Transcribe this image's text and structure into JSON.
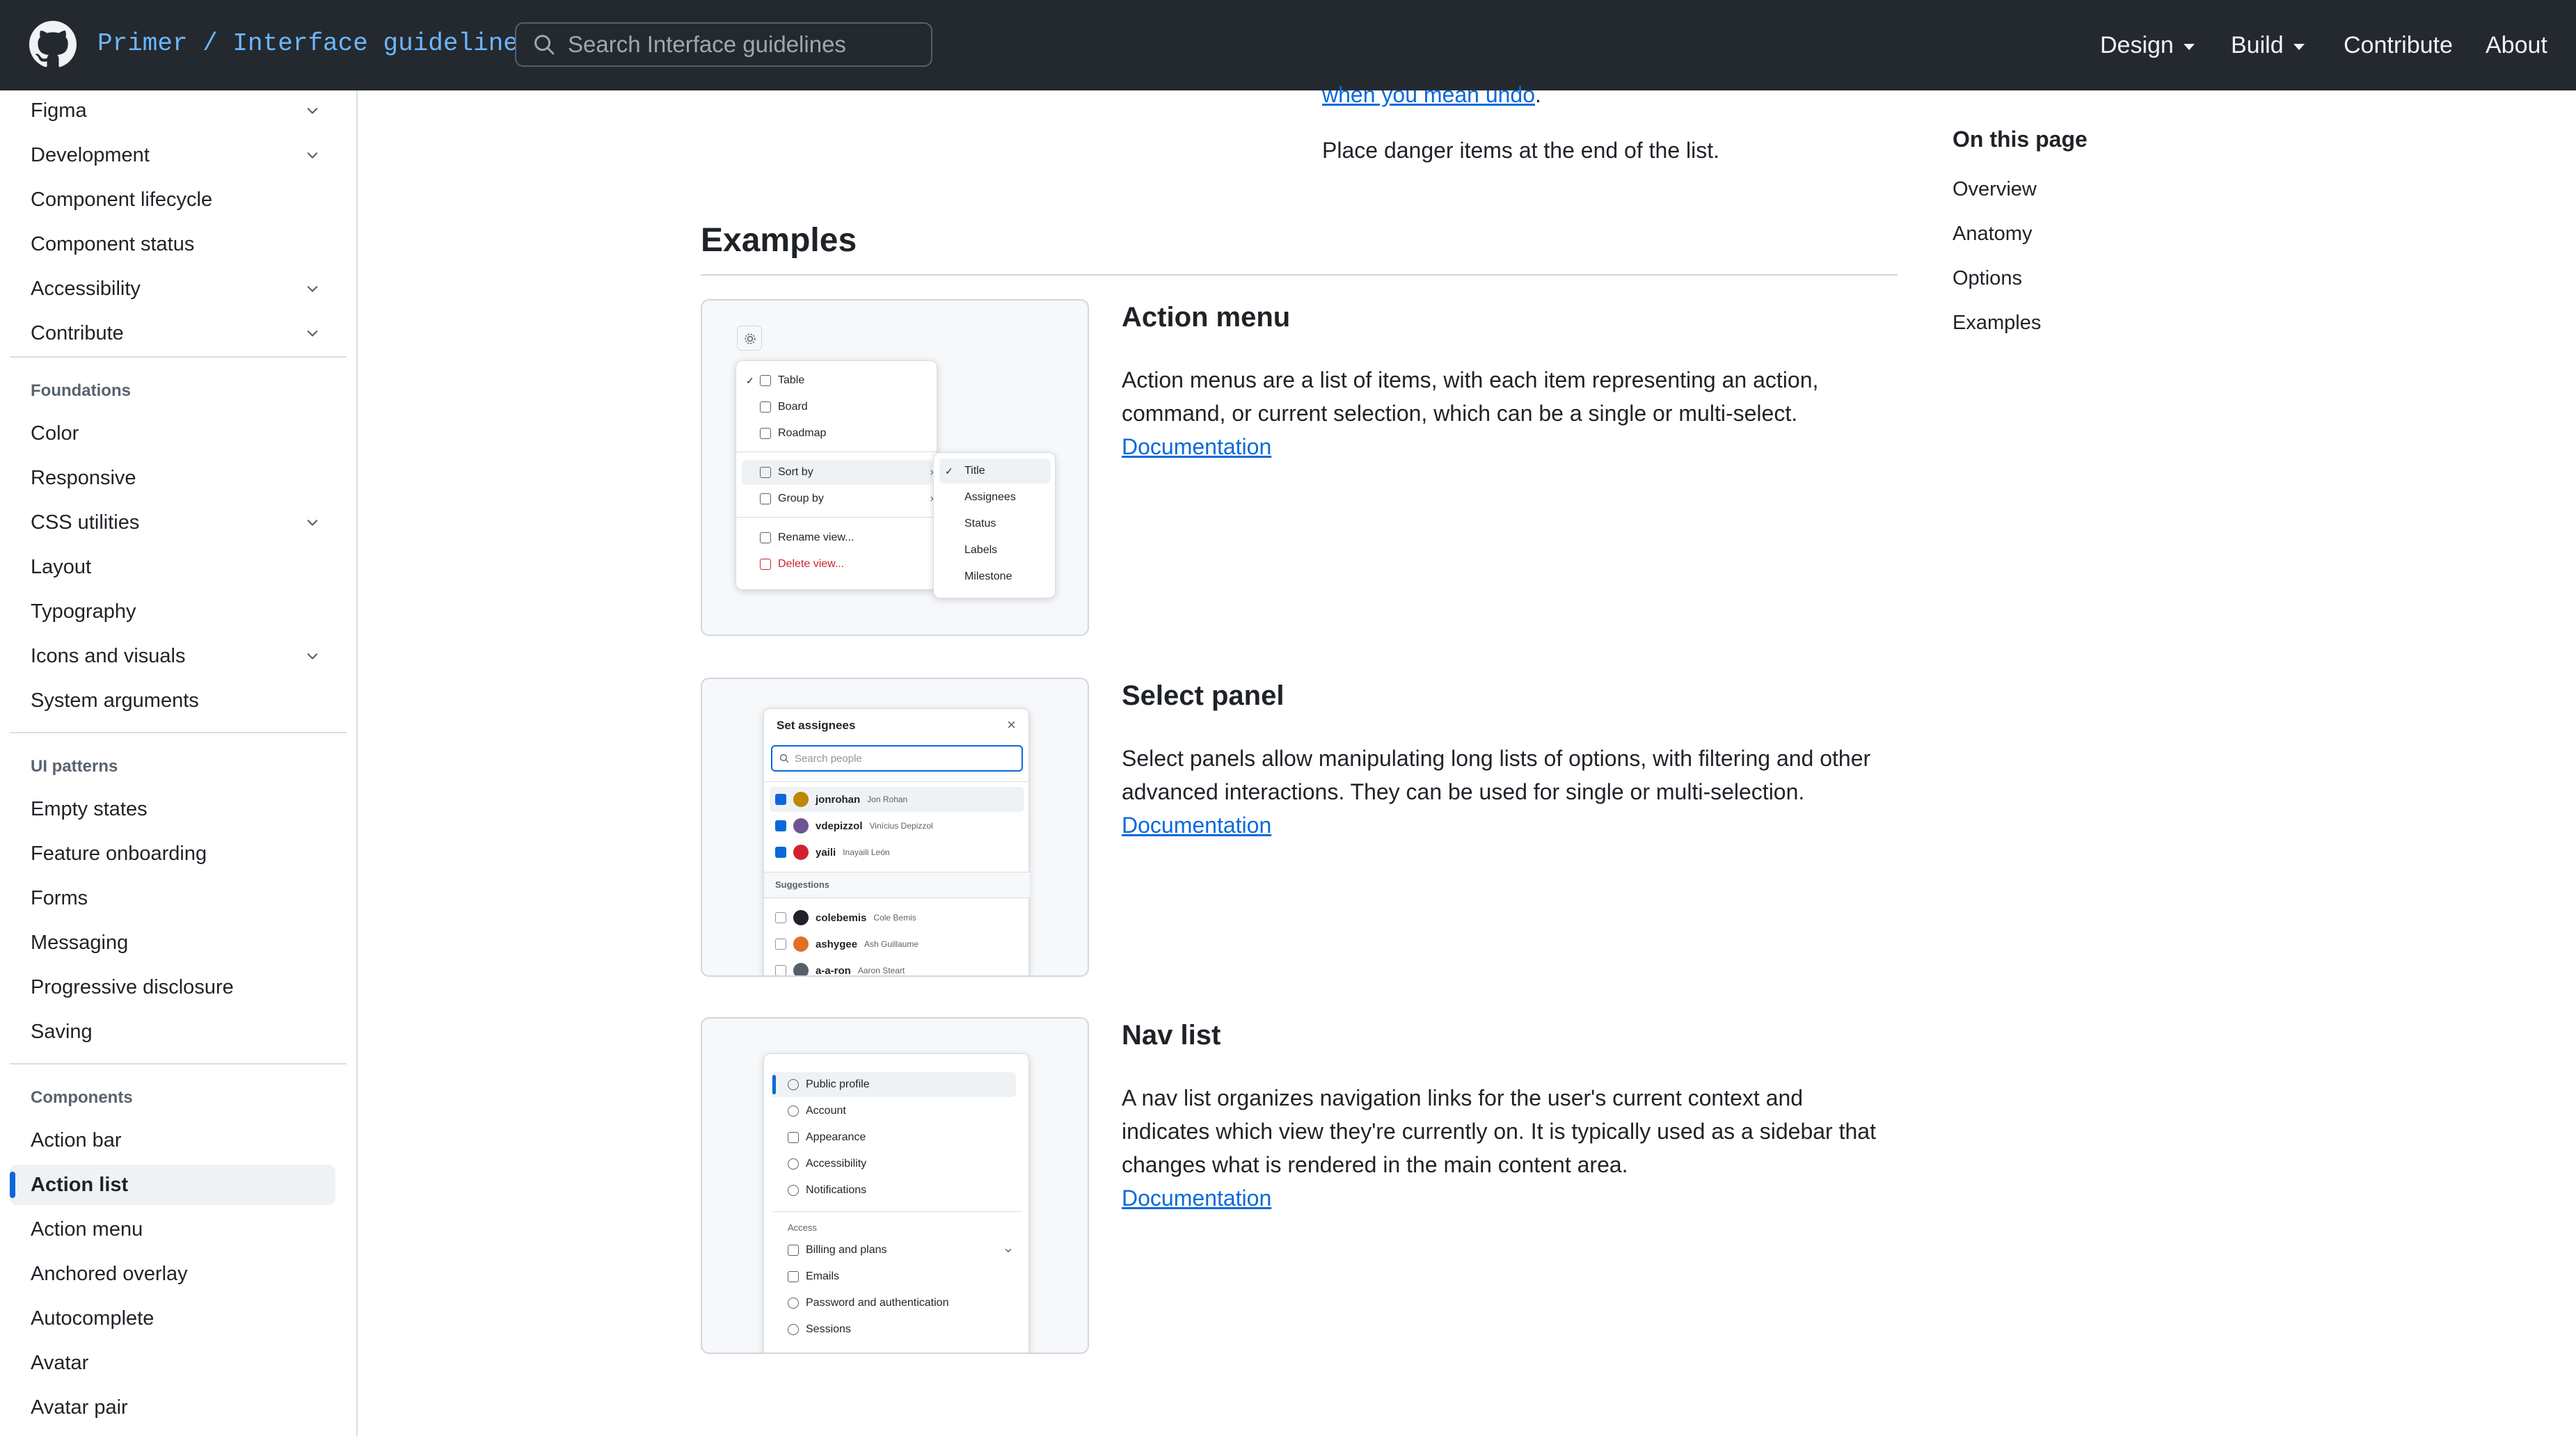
{
  "header": {
    "brand": "Primer / Interface guidelines",
    "search_placeholder": "Search Interface guidelines",
    "nav": {
      "design": "Design",
      "build": "Build",
      "contribute": "Contribute",
      "about": "About"
    }
  },
  "sidebar": {
    "top_items": [
      "Figma",
      "Development",
      "Component lifecycle",
      "Component status",
      "Accessibility",
      "Contribute"
    ],
    "foundations_heading": "Foundations",
    "foundations": [
      "Color",
      "Responsive",
      "CSS utilities",
      "Layout",
      "Typography",
      "Icons and visuals",
      "System arguments"
    ],
    "ui_patterns_heading": "UI patterns",
    "ui_patterns": [
      "Empty states",
      "Feature onboarding",
      "Forms",
      "Messaging",
      "Progressive disclosure",
      "Saving"
    ],
    "components_heading": "Components",
    "components": [
      "Action bar",
      "Action list",
      "Action menu",
      "Anchored overlay",
      "Autocomplete",
      "Avatar",
      "Avatar pair"
    ]
  },
  "main": {
    "intro_link": "when you mean undo",
    "intro_period": ".",
    "intro_text": "Place danger items at the end of the list.",
    "section_title": "Examples",
    "cards": [
      {
        "title": "Action menu",
        "desc_lines": [
          "Action menus are a list of items, with each item representing an action,",
          "command, or current selection, which can be a single or multi-select."
        ],
        "link": "Documentation"
      },
      {
        "title": "Select panel",
        "desc_lines": [
          "Select panels allow manipulating long lists of options, with filtering and other",
          "advanced interactions. They can be used for single or multi-selection."
        ],
        "link": "Documentation"
      },
      {
        "title": "Nav list",
        "desc_lines": [
          "A nav list organizes navigation links for the user's current context and",
          "indicates which view they're currently on. It is typically used as a sidebar that",
          "changes what is rendered in the main content area."
        ],
        "link": "Documentation"
      }
    ],
    "thumb_action_menu": {
      "items": [
        "Table",
        "Board",
        "Roadmap"
      ],
      "sort_by": "Sort by",
      "group_by": "Group by",
      "rename": "Rename view...",
      "delete": "Delete view...",
      "sub_items": [
        "Title",
        "Assignees",
        "Status",
        "Labels",
        "Milestone"
      ]
    },
    "thumb_select_panel": {
      "title": "Set assignees",
      "close": "×",
      "search": "Search people",
      "selected": [
        {
          "login": "jonrohan",
          "name": "Jon Rohan"
        },
        {
          "login": "vdepizzol",
          "name": "Vinícius Depizzol"
        },
        {
          "login": "yaili",
          "name": "Inayaili León"
        }
      ],
      "suggestions_label": "Suggestions",
      "suggestions": [
        {
          "login": "colebemis",
          "name": "Cole Bemis"
        },
        {
          "login": "ashygee",
          "name": "Ash Guillaume"
        },
        {
          "login": "a-a-ron",
          "name": "Aaron Steart"
        }
      ]
    },
    "thumb_nav_list": {
      "items": [
        "Public profile",
        "Account",
        "Appearance",
        "Accessibility",
        "Notifications"
      ],
      "access_label": "Access",
      "access_items": [
        "Billing and plans",
        "Emails",
        "Password and authentication",
        "Sessions"
      ]
    }
  },
  "toc": {
    "title": "On this page",
    "items": [
      "Overview",
      "Anatomy",
      "Options",
      "Examples"
    ]
  },
  "colors": {
    "header_bg": "#24292f",
    "link": "#0969da",
    "brand": "#6cb6ff",
    "danger": "#cf222e",
    "active_indicator": "#0969da"
  }
}
